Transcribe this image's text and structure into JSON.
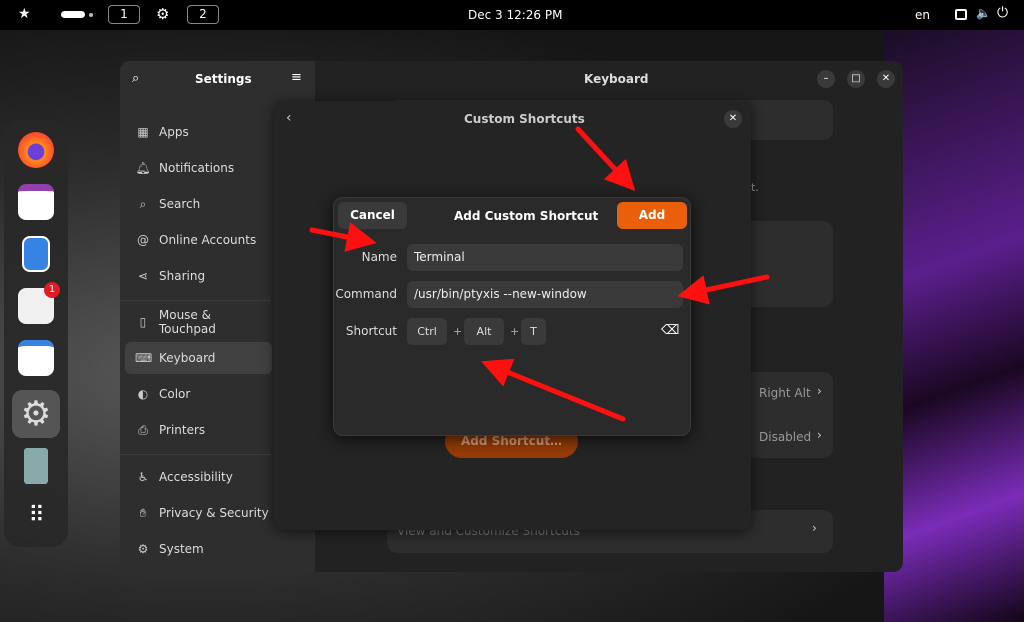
{
  "topbar": {
    "workspace1": "1",
    "workspace2": "2",
    "clock": "Dec 3  12:26 PM",
    "language": "en"
  },
  "settings": {
    "sidebar_title": "Settings",
    "page_title": "Keyboard",
    "sidebar_items": [
      {
        "label": "Apps",
        "icon": "apps-icon"
      },
      {
        "label": "Notifications",
        "icon": "bell-icon"
      },
      {
        "label": "Search",
        "icon": "search-icon"
      },
      {
        "label": "Online Accounts",
        "icon": "at-icon"
      },
      {
        "label": "Sharing",
        "icon": "share-icon"
      },
      {
        "label": "Mouse & Touchpad",
        "icon": "mouse-icon"
      },
      {
        "label": "Keyboard",
        "icon": "keyboard-icon"
      },
      {
        "label": "Color",
        "icon": "color-icon"
      },
      {
        "label": "Printers",
        "icon": "printer-icon"
      },
      {
        "label": "Accessibility",
        "icon": "accessibility-icon"
      },
      {
        "label": "Privacy & Security",
        "icon": "hand-icon"
      },
      {
        "label": "System",
        "icon": "gear-icon"
      }
    ],
    "background": {
      "partial_text": "ut.",
      "right_alt": "Right Alt",
      "disabled": "Disabled",
      "add_shortcut": "Add Shortcut…",
      "view_customize": "View and Customize Shortcuts"
    }
  },
  "custom_shortcuts": {
    "title": "Custom Shortcuts"
  },
  "add_dialog": {
    "title": "Add Custom Shortcut",
    "cancel": "Cancel",
    "add": "Add",
    "name_label": "Name",
    "name_value": "Terminal",
    "command_label": "Command",
    "command_value": "/usr/bin/ptyxis --new-window",
    "shortcut_label": "Shortcut",
    "keys": [
      "Ctrl",
      "Alt",
      "T"
    ],
    "plus": "+"
  },
  "dock": {
    "badge": "1"
  },
  "colors": {
    "accent": "#e95f0c",
    "arrow": "#ff1010"
  }
}
